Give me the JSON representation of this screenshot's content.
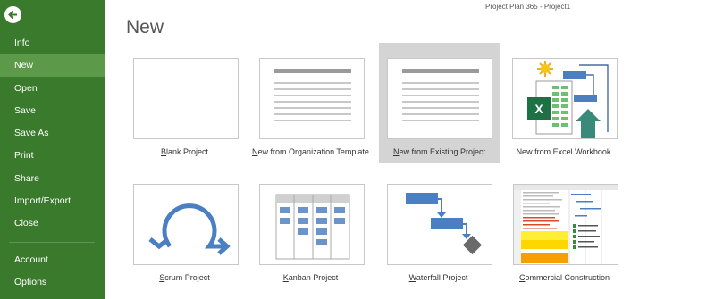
{
  "app_title": "Project Plan 365 - Project1",
  "page_heading": "New",
  "sidebar": {
    "back_icon": "back-arrow-icon",
    "items": [
      {
        "label": "Info"
      },
      {
        "label": "New",
        "active": true
      },
      {
        "label": "Open"
      },
      {
        "label": "Save"
      },
      {
        "label": "Save As"
      },
      {
        "label": "Print"
      },
      {
        "label": "Share"
      },
      {
        "label": "Import/Export"
      },
      {
        "label": "Close"
      },
      {
        "label": "Account"
      },
      {
        "label": "Options"
      }
    ]
  },
  "templates": [
    {
      "mnemonic": "B",
      "rest": "lank Project",
      "selected": false
    },
    {
      "mnemonic": "N",
      "rest": "ew from Organization Template",
      "selected": false
    },
    {
      "mnemonic": "N",
      "rest": "ew from Existing Project",
      "selected": true
    },
    {
      "mnemonic": "",
      "rest": "New from Excel Workbook",
      "selected": false
    },
    {
      "mnemonic": "S",
      "rest": "crum Project",
      "selected": false
    },
    {
      "mnemonic": "K",
      "rest": "anban Project",
      "selected": false
    },
    {
      "mnemonic": "W",
      "rest": "aterfall Project",
      "selected": false
    },
    {
      "mnemonic": "C",
      "rest": "ommercial Construction",
      "selected": false
    }
  ],
  "colors": {
    "sidebar": "#3a7a2c",
    "sidebar_active": "#5c9a4a",
    "accent_blue": "#4a7fc1",
    "excel_green": "#1e7145"
  }
}
